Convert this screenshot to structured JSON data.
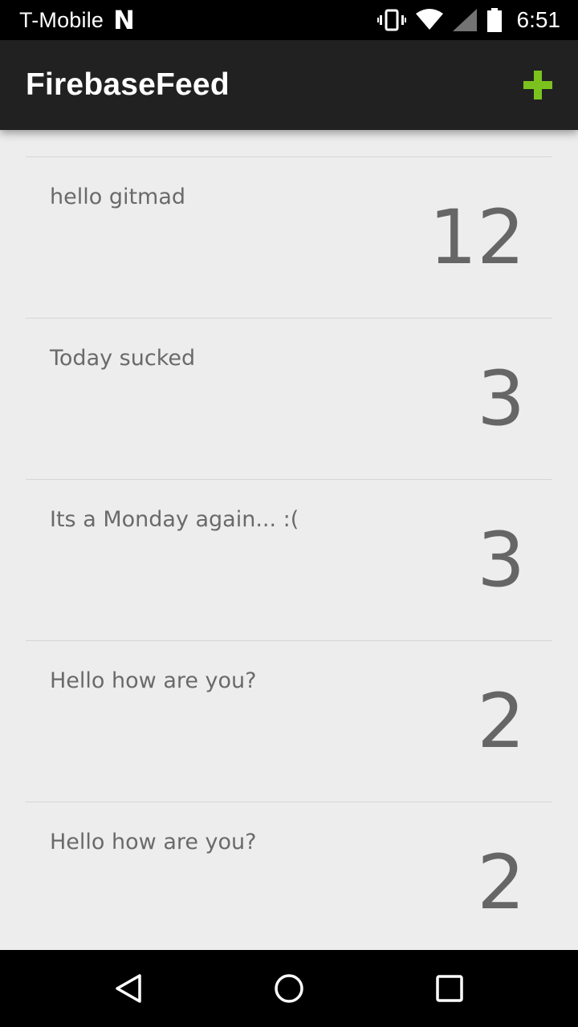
{
  "status_bar": {
    "carrier": "T-Mobile",
    "notification_icon": "N",
    "time": "6:51",
    "icons": [
      "vibrate-icon",
      "wifi-icon",
      "signal-icon",
      "battery-icon"
    ]
  },
  "app_bar": {
    "title": "FirebaseFeed",
    "add_icon": "plus-icon",
    "accent_color": "#7cc21f"
  },
  "feed": {
    "items": [
      {
        "text": "hello gitmad",
        "count": "12"
      },
      {
        "text": "Today sucked",
        "count": "3"
      },
      {
        "text": "Its a Monday again... :(",
        "count": "3"
      },
      {
        "text": "Hello how are you?",
        "count": "2"
      },
      {
        "text": "Hello how are you?",
        "count": "2"
      }
    ]
  },
  "nav_bar": {
    "buttons": [
      "back-icon",
      "home-icon",
      "recents-icon"
    ]
  }
}
